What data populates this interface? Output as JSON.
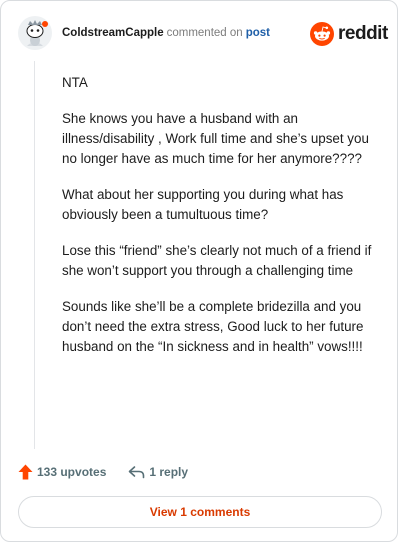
{
  "header": {
    "username": "ColdstreamCapple",
    "action_text": "commented on",
    "post_link": "post",
    "brand": "reddit"
  },
  "comment": {
    "paragraphs": [
      "NTA",
      "She knows you have a husband with an illness/disability , Work full time and she’s upset you no longer have as much time for her anymore????",
      "What about her supporting you during what has obviously been a tumultuous time?",
      "Lose this “friend” she’s clearly not much of a friend if she won’t support you through a challenging time",
      "Sounds like she’ll be a complete bridezilla and you don’t need the extra stress, Good luck to her future husband on the “In sickness and in health” vows!!!!"
    ]
  },
  "actions": {
    "upvotes": "133 upvotes",
    "reply": "1 reply"
  },
  "view_comments_label": "View 1 comments",
  "colors": {
    "brand_orange": "#ff4500",
    "link_blue": "#1f5fa8",
    "button_text": "#d93a00"
  },
  "icons": {
    "avatar": "snoo-avatar-icon",
    "logo": "reddit-logo-icon",
    "upvote": "upvote-arrow-icon",
    "reply": "reply-arrow-icon"
  }
}
